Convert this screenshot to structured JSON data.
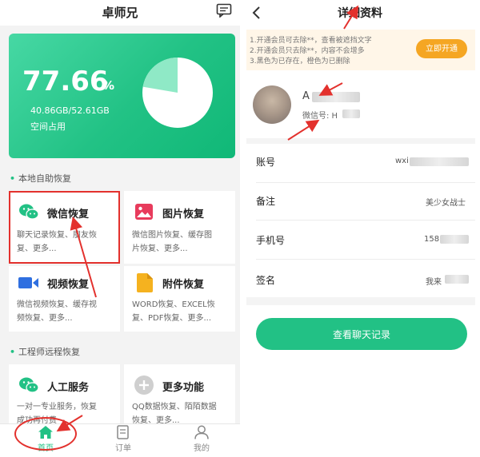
{
  "left": {
    "app_title": "卓师兄",
    "storage": {
      "percent": "77.66",
      "percent_sign": "%",
      "used": "40.86GB/52.61GB",
      "label": "空间占用",
      "used_fraction": 0.7766
    },
    "section_local": "本地自助恢复",
    "tiles": [
      {
        "title": "微信恢复",
        "desc1": "聊天记录恢复、朋友恢",
        "desc2": "复、更多...",
        "icon": "wechat-icon"
      },
      {
        "title": "图片恢复",
        "desc1": "微信图片恢复、缓存图",
        "desc2": "片恢复、更多...",
        "icon": "image-icon"
      },
      {
        "title": "视频恢复",
        "desc1": "微信视频恢复、缓存视",
        "desc2": "频恢复、更多...",
        "icon": "video-icon"
      },
      {
        "title": "附件恢复",
        "desc1": "WORD恢复、EXCEL恢",
        "desc2": "复、PDF恢复、更多...",
        "icon": "file-icon"
      }
    ],
    "section_remote": "工程师远程恢复",
    "remote_tiles": [
      {
        "title": "人工服务",
        "desc1": "一对一专业服务，恢复",
        "desc2": "成功再付费",
        "icon": "wechat-icon"
      },
      {
        "title": "更多功能",
        "desc1": "QQ数据恢复、陌陌数据",
        "desc2": "恢复、更多...",
        "icon": "plus-icon"
      }
    ],
    "nav": [
      {
        "label": "首页",
        "icon": "home-icon",
        "active": true
      },
      {
        "label": "订单",
        "icon": "order-icon",
        "active": false
      },
      {
        "label": "我的",
        "icon": "user-icon",
        "active": false
      }
    ],
    "colors": {
      "accent": "#21c184",
      "highlight": "#e3312d"
    }
  },
  "right": {
    "title": "详细资料",
    "notice": [
      "1.开通会员可去除**，查看被遮挡文字",
      "2.开通会员只去除**，内容不会增多",
      "3.黑色为已存在，橙色为已删除"
    ],
    "open_button": "立即开通",
    "profile": {
      "nickname_initial": "A",
      "wechat_id_label": "微信号: H"
    },
    "rows": [
      {
        "label": "账号",
        "value": "wxi"
      },
      {
        "label": "备注",
        "value": "美少女战士"
      },
      {
        "label": "手机号",
        "value": "158"
      },
      {
        "label": "签名",
        "value": "我来"
      }
    ],
    "view_chat_button": "查看聊天记录",
    "colors": {
      "accent": "#22c185",
      "button_orange": "#f5a623"
    }
  }
}
